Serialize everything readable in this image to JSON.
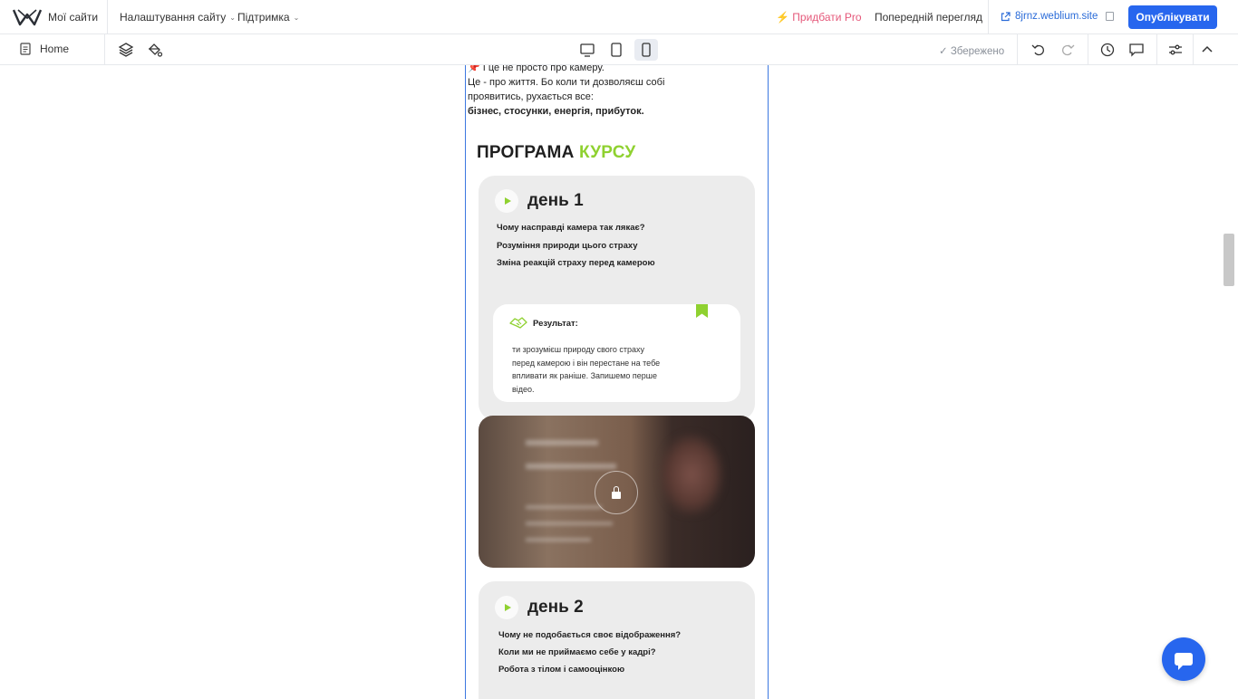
{
  "header": {
    "brand": "Мої сайти",
    "menu": [
      {
        "label": "Налаштування сайту"
      },
      {
        "label": "Підтримка"
      }
    ],
    "pro_label": "Придбати Pro",
    "preview_label": "Попередній перегляд",
    "site_url": "8jrnz.weblium.site",
    "publish_label": "Опублікувати"
  },
  "toolbar": {
    "page_name": "Home",
    "saved_label": "Збережено",
    "active_device": "mobile"
  },
  "content": {
    "intro": {
      "line1": "📌 І це не просто про камеру.",
      "line2": "Це - про життя. Бо коли ти дозволяєш собі проявитись, рухається все:",
      "line3": "бізнес, стосунки, енергія, прибуток."
    },
    "program_title": {
      "part1": "ПРОГРАМА",
      "part2": "КУРСУ"
    },
    "days": [
      {
        "label": "день 1",
        "topics": [
          "Чому насправді камера так лякає?",
          "Розуміння природи цього страху",
          "Зміна реакцій страху перед камерою"
        ],
        "result_label": "Результат:",
        "result_text": "ти зрозумієш природу свого страху перед камерою і він перестане на тебе впливати як раніше. Запишемо перше відео."
      },
      {
        "label": "день 2",
        "topics": [
          "Чому не подобається своє відображення?",
          "Коли ми не приймаємо себе у кадрі?",
          "Робота з тілом і самооцінкою"
        ]
      }
    ]
  },
  "colors": {
    "accent_green": "#8fd130",
    "publish_blue": "#2766ee",
    "pro_pink": "#e5587a",
    "link_blue": "#2a6bd8",
    "frame_border": "#3c78e0"
  }
}
